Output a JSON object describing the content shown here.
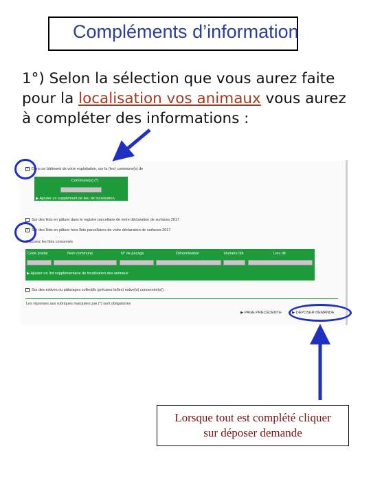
{
  "slide": {
    "title": "Compléments d’information",
    "intro_part1": "1°) Selon la sélection que vous aurez faite pour la ",
    "intro_link": "localisation vos animaux",
    "intro_part2": " vous aurez à compléter des informations :",
    "callout_line1": "Lorsque tout est complété cliquer",
    "callout_line2": "sur déposer demande"
  },
  "form": {
    "checkbox1_label": "Dans un bâtiment de votre exploitation, sur la (les) commune(s) de",
    "communes_header": "Commune(s) (*)",
    "add_commune_link": "Ajouter un supplément de lieu de localisation",
    "checkbox2_label": "Sur des îlots en pâture dans le registre parcellaire de votre déclaration de surfaces 2017",
    "checkbox3_label": "Sur des îlots en pâture hors îlots parcellaires de votre déclaration de surfaces 2017",
    "hors_ilots_label": "Précisez les îlots concernés",
    "columns": [
      "Code postal",
      "Nom commune",
      "N° de pacage",
      "Dénomination",
      "Numéro îlot",
      "Lieu dit"
    ],
    "add_ilot_link": "Ajouter un îlot supplémentaire de localisation des animaux",
    "checkbox4_label": "Sur des estives ou pâturages collectifs (précisez la(les) estive(s) concernée(s))",
    "required_note": "Les réponses aux rubriques marquées par (*) sont obligatoires",
    "prev_button": "PAGE PRÉCÉDENTE",
    "submit_button": "DÉPOSER DEMANDE"
  },
  "colors": {
    "title": "#2b3f9e",
    "link": "#a33a1f",
    "form_green": "#1d9a3a",
    "annotation_blue": "#1f30c0",
    "callout_text": "#7a1410"
  }
}
